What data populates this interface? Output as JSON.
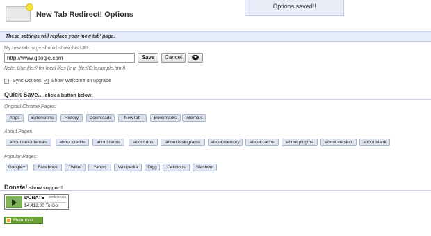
{
  "header": {
    "title": "New Tab Redirect! Options",
    "save_status": "Options saved!!"
  },
  "banner": "These settings will replace your 'new tab' page.",
  "url_section": {
    "label": "My new tab page should show this URL:",
    "url_value": "http://www.google.com",
    "save_label": "Save",
    "cancel_label": "Cancel",
    "cloud_icon": "cloud-icon",
    "note": "Note: Use file:// for local files (e.g. file://C:\\example.html)"
  },
  "options": {
    "sync_label": "Sync Options",
    "sync_checked": false,
    "welcome_label": "Show Welcome on upgrade",
    "welcome_checked": true
  },
  "quick_save": {
    "title": "Quick Save...",
    "subtitle": "click a button below!",
    "groups": [
      {
        "label": "Original Chrome Pages:",
        "items": [
          "Apps",
          "Extensions",
          "History",
          "Downloads",
          "NewTab",
          "Bookmarks",
          "Internals"
        ]
      },
      {
        "label": "About Pages:",
        "items": [
          "about:net-internals",
          "about:credits",
          "about:terms",
          "about:dns",
          "about:histograms",
          "about:memory",
          "about:cache",
          "about:plugins",
          "about:version",
          "about:blank"
        ]
      },
      {
        "label": "Popular Pages:",
        "items": [
          "Google+",
          "Facebook",
          "Twitter",
          "Yahoo",
          "Wikipedia",
          "Digg",
          "Delicious",
          "Slashdot"
        ]
      }
    ]
  },
  "donate": {
    "title": "Donate!",
    "subtitle": "show support!",
    "button_label": "DONATE",
    "brand": "pledgie.com",
    "amount": "$4,412.00 To Go!",
    "flattr_label": "Flattr this!"
  }
}
